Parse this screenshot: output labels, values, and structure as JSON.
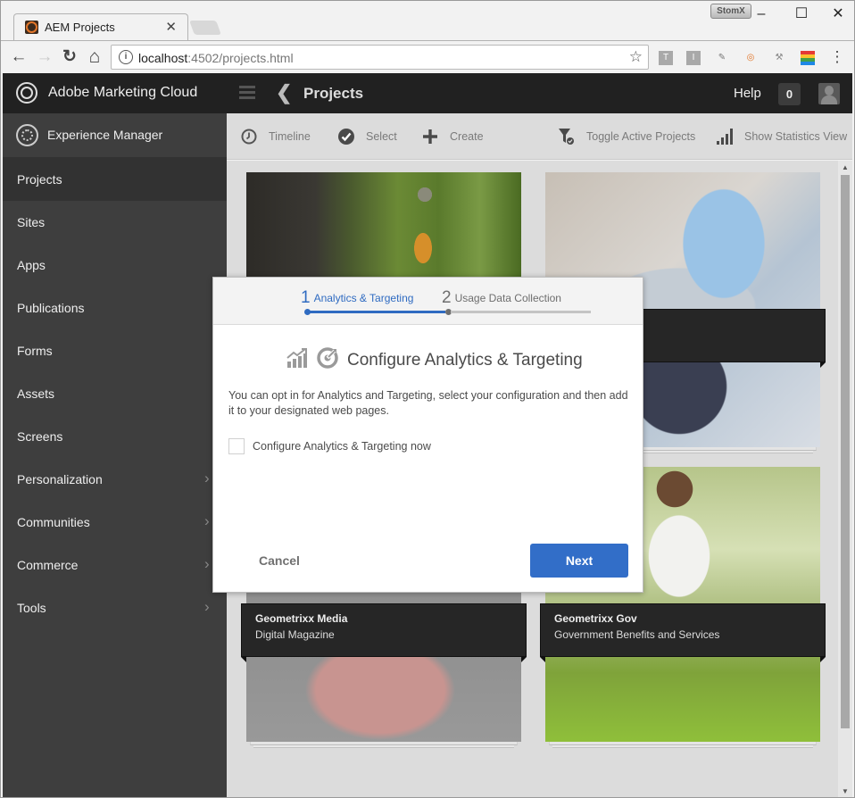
{
  "browser": {
    "tab_title": "AEM Projects",
    "tab_close": "✕",
    "url_host": "localhost",
    "url_path": ":4502/projects.html",
    "extension_badge": "StomX",
    "window_controls": [
      "–",
      "☐",
      "✕"
    ],
    "nav": {
      "back": "←",
      "forward": "→",
      "reload": "↻",
      "home": "⌂"
    },
    "star": "☆",
    "info": "i",
    "extensions": [
      {
        "name": "t-extension-icon",
        "glyph": "T",
        "bg": "#a9a9a9",
        "fg": "#fff"
      },
      {
        "name": "i-extension-icon",
        "glyph": "I",
        "bg": "#a9a9a9",
        "fg": "#fff"
      },
      {
        "name": "clipboard-extension-icon",
        "glyph": "✎",
        "bg": "transparent",
        "fg": "#777"
      },
      {
        "name": "ring-extension-icon",
        "glyph": "◎",
        "bg": "transparent",
        "fg": "#e2762a"
      },
      {
        "name": "tools-extension-icon",
        "glyph": "⚒",
        "bg": "transparent",
        "fg": "#888"
      },
      {
        "name": "stripes-extension-icon",
        "glyph": "",
        "bg": "linear-gradient(#e53935 0 25%,#fbc02d 25% 50%,#43a047 50% 75%,#1e88e5 75%)",
        "fg": "#fff"
      }
    ],
    "menu": "⋮"
  },
  "shell": {
    "brand": "Adobe Marketing Cloud",
    "title": "Projects",
    "help": "Help",
    "notifications": "0"
  },
  "sidebar": {
    "header": "Experience Manager",
    "items": [
      {
        "label": "Projects",
        "active": true,
        "chevron": false
      },
      {
        "label": "Sites",
        "active": false,
        "chevron": false
      },
      {
        "label": "Apps",
        "active": false,
        "chevron": false
      },
      {
        "label": "Publications",
        "active": false,
        "chevron": false
      },
      {
        "label": "Forms",
        "active": false,
        "chevron": false
      },
      {
        "label": "Assets",
        "active": false,
        "chevron": false
      },
      {
        "label": "Screens",
        "active": false,
        "chevron": false
      },
      {
        "label": "Personalization",
        "active": false,
        "chevron": true
      },
      {
        "label": "Communities",
        "active": false,
        "chevron": true
      },
      {
        "label": "Commerce",
        "active": false,
        "chevron": true
      },
      {
        "label": "Tools",
        "active": false,
        "chevron": true
      }
    ],
    "chevron_glyph": "›"
  },
  "actionbar": {
    "timeline": "Timeline",
    "select": "Select",
    "create": "Create",
    "toggle_active": "Toggle Active Projects",
    "statistics": "Show Statistics View"
  },
  "cards": [
    {
      "title": "",
      "description": "",
      "image": "hiker"
    },
    {
      "title": "",
      "description": "",
      "image": "sitting-person"
    },
    {
      "title": "Geometrixx Media",
      "description": "Digital Magazine",
      "image": "phone-hands"
    },
    {
      "title": "Geometrixx Gov",
      "description": "Government Benefits and Services",
      "image": "family-walking"
    }
  ],
  "dialog": {
    "steps": [
      {
        "number": "1",
        "label": "Analytics & Targeting",
        "active": true
      },
      {
        "number": "2",
        "label": "Usage Data Collection",
        "active": false
      }
    ],
    "title": "Configure Analytics & Targeting",
    "text": "You can opt in for Analytics and Targeting, select your configuration and then add it to your designated web pages.",
    "checkbox_label": "Configure Analytics & Targeting now",
    "checkbox_checked": false,
    "cancel": "Cancel",
    "next": "Next"
  },
  "colors": {
    "accent": "#326ec8",
    "step_active": "#2f6bc1",
    "step_inactive": "#6e6e6e",
    "shell_bg": "#212121",
    "sidebar_bg": "#3e3e3e"
  }
}
